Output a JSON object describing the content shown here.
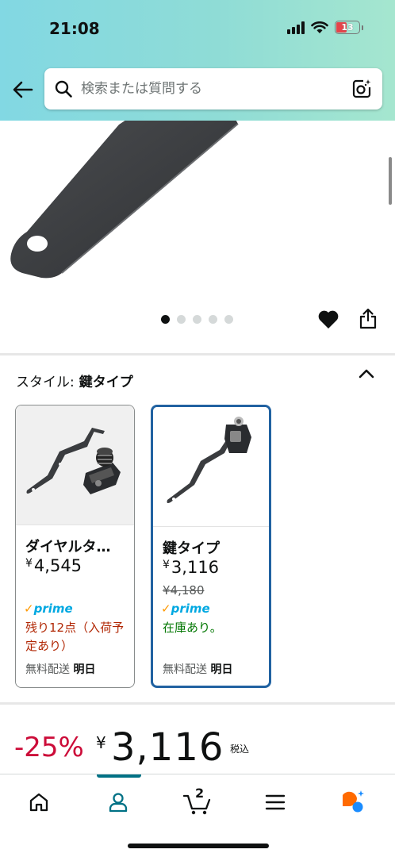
{
  "status_bar": {
    "time": "21:08",
    "battery": "13"
  },
  "search": {
    "placeholder": "検索または質問する"
  },
  "carousel": {
    "count": 5,
    "active_index": 0
  },
  "style_selector": {
    "label": "スタイル:",
    "selected": "鍵タイプ",
    "options": [
      {
        "title": "ダイヤルタ…",
        "price": "4,545",
        "currency": "¥",
        "prime": "prime",
        "stock": "残り12点（入荷予定あり）",
        "shipping": "無料配送",
        "delivery_day": "明日",
        "selected": false
      },
      {
        "title": "鍵タイプ",
        "price": "3,116",
        "currency": "¥",
        "list_price": "¥4,180",
        "prime": "prime",
        "stock": "在庫あり。",
        "shipping": "無料配送",
        "delivery_day": "明日",
        "selected": true
      }
    ]
  },
  "price": {
    "discount": "-25%",
    "currency": "¥",
    "amount": "3,116",
    "tax_note": "税込"
  },
  "bottom_nav": {
    "cart_count": "2"
  },
  "colors": {
    "header_gradient_start": "#82d8e3",
    "header_gradient_end": "#a5e6cf",
    "selected_border": "#2162a1",
    "discount_red": "#cc0c39",
    "stock_low": "#b12704",
    "stock_ok": "#007600",
    "prime_blue": "#00a8e1",
    "nav_active": "#007185"
  }
}
